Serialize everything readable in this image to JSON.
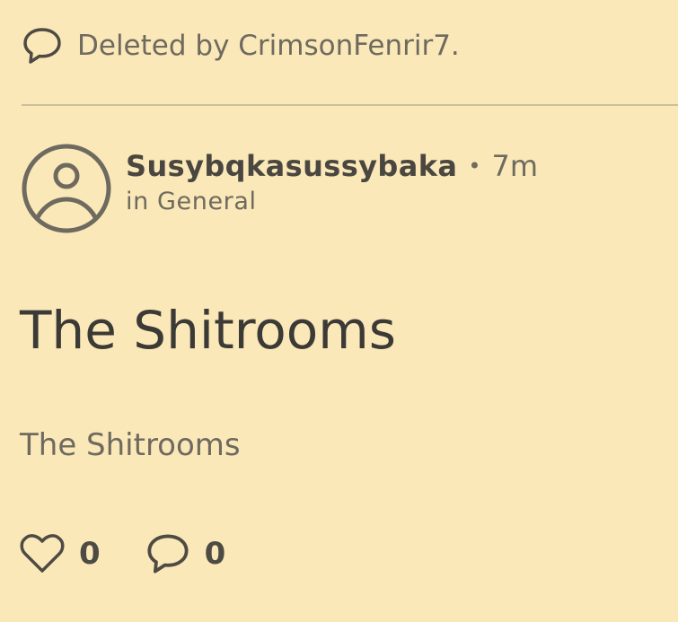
{
  "deleted_notice": {
    "text": "Deleted by CrimsonFenrir7.",
    "icon": "comment-icon"
  },
  "post": {
    "author": "Susybqkasussybaka",
    "separator": "•",
    "time": "7m",
    "community": "in General",
    "title": "The Shitrooms",
    "body": "The Shitrooms",
    "likes": "0",
    "comments": "0"
  },
  "colors": {
    "background": "#fbe8b8",
    "text_muted": "#6e6a5f",
    "text_dark": "#3b3a36",
    "divider": "#cbbf9f"
  },
  "icons": {
    "avatar": "user-avatar-icon",
    "like": "heart-icon",
    "comment": "comment-icon"
  }
}
